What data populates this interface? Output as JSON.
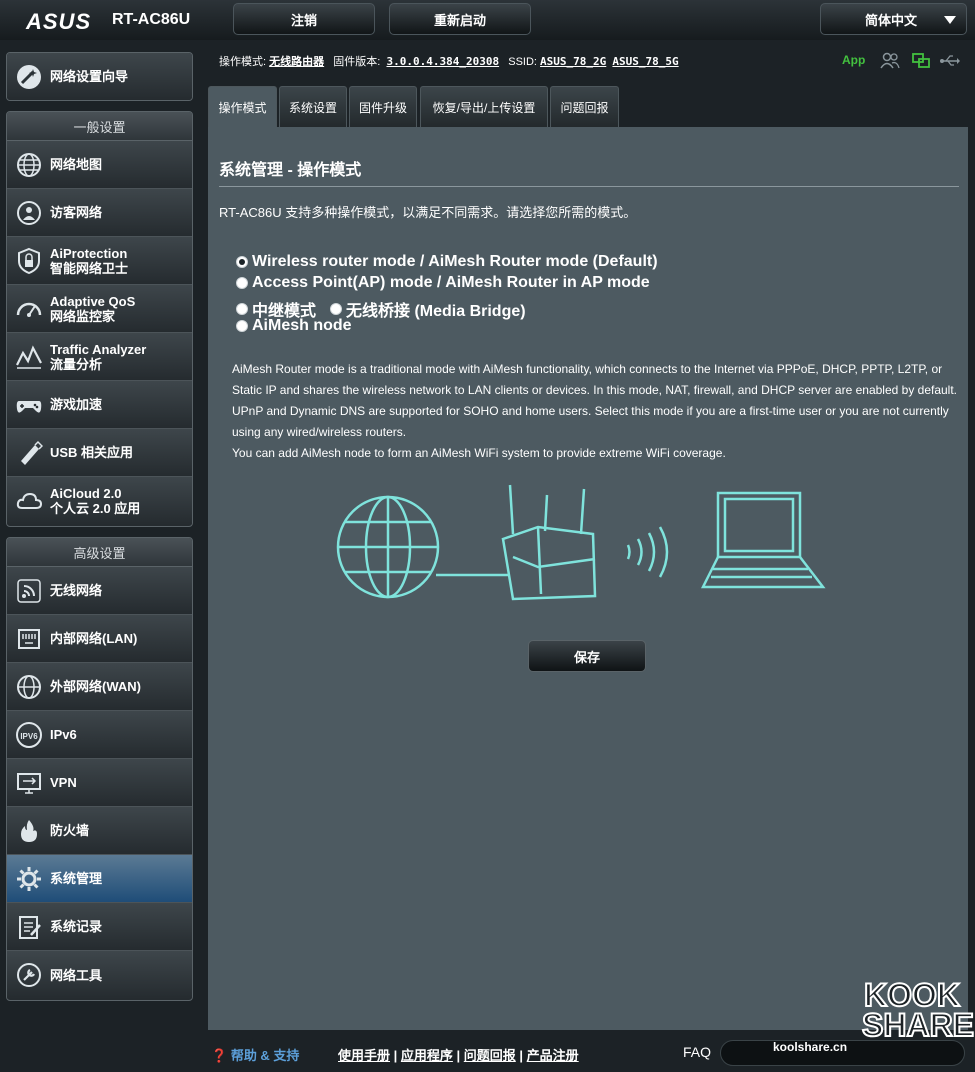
{
  "header": {
    "brand": "ASUS",
    "model": "RT-AC86U",
    "logout_label": "注销",
    "reboot_label": "重新启动",
    "language": "简体中文"
  },
  "status": {
    "mode_label": "操作模式:",
    "mode_value": "无线路由器",
    "firmware_label": "固件版本:",
    "firmware_value": "3.0.0.4.384_20308",
    "ssid_label": "SSID:",
    "ssid_2g": "ASUS_78_2G",
    "ssid_5g": "ASUS_78_5G",
    "app_label": "App"
  },
  "sidebar": {
    "wizard": "网络设置向导",
    "general_head": "一般设置",
    "general": [
      {
        "label": "网络地图",
        "icon": "globe-map-icon"
      },
      {
        "label": "访客网络",
        "icon": "guest-network-icon"
      },
      {
        "label": "AiProtection",
        "label2": "智能网络卫士",
        "icon": "shield-lock-icon"
      },
      {
        "label": "Adaptive QoS",
        "label2": "网络监控家",
        "icon": "speedometer-icon"
      },
      {
        "label": "Traffic Analyzer",
        "label2": "流量分析",
        "icon": "traffic-chart-icon"
      },
      {
        "label": "游戏加速",
        "icon": "gamepad-icon"
      },
      {
        "label": "USB 相关应用",
        "icon": "usb-pen-icon"
      },
      {
        "label": "AiCloud 2.0",
        "label2": "个人云 2.0 应用",
        "icon": "cloud-icon"
      }
    ],
    "advanced_head": "高级设置",
    "advanced": [
      {
        "label": "无线网络",
        "icon": "wireless-icon"
      },
      {
        "label": "内部网络(LAN)",
        "icon": "lan-port-icon"
      },
      {
        "label": "外部网络(WAN)",
        "icon": "wan-globe-icon"
      },
      {
        "label": "IPv6",
        "icon": "ipv6-icon"
      },
      {
        "label": "VPN",
        "icon": "vpn-monitor-icon"
      },
      {
        "label": "防火墙",
        "icon": "firewall-flame-icon"
      },
      {
        "label": "系统管理",
        "icon": "admin-gear-icon",
        "active": true
      },
      {
        "label": "系统记录",
        "icon": "system-log-icon"
      },
      {
        "label": "网络工具",
        "icon": "network-tools-icon"
      }
    ]
  },
  "tabs": [
    "操作模式",
    "系统设置",
    "固件升级",
    "恢复/导出/上传设置",
    "问题回报"
  ],
  "main": {
    "title": "系统管理 - 操作模式",
    "description": "RT-AC86U 支持多种操作模式，以满足不同需求。请选择您所需的模式。",
    "modes": [
      {
        "label": "Wireless router mode / AiMesh Router mode (Default)",
        "selected": true
      },
      {
        "label": "Access Point(AP) mode / AiMesh Router in AP mode",
        "selected": false
      },
      {
        "label": "中继模式",
        "selected": false
      },
      {
        "label": "无线桥接 (Media Bridge)",
        "selected": false
      },
      {
        "label": "AiMesh node",
        "selected": false
      }
    ],
    "explain_1": "AiMesh Router mode is a traditional mode with AiMesh functionality, which connects to the Internet via PPPoE, DHCP, PPTP, L2TP, or Static IP and shares the wireless network to LAN clients or devices. In this mode, NAT, firewall, and DHCP server are enabled by default. UPnP and Dynamic DNS are supported for SOHO and home users. Select this mode if you are a first-time user or you are not currently using any wired/wireless routers.",
    "explain_2": "You can add AiMesh node to form an AiMesh WiFi system to provide extreme WiFi coverage.",
    "save_label": "保存"
  },
  "footer": {
    "help": "帮助 & 支持",
    "manual": "使用手册",
    "app": "应用程序",
    "feedback": "问题回报",
    "register": "产品注册",
    "faq": "FAQ"
  },
  "watermark": {
    "site": "koolshare.cn",
    "logo_line1": "KOOK",
    "logo_line2": "SHARE"
  },
  "colors": {
    "panel": "#4d5a61",
    "background": "#1c2226",
    "app_green": "#43c13f",
    "active_item": "#1f4d78",
    "illustration_line": "#7fe3dc"
  }
}
